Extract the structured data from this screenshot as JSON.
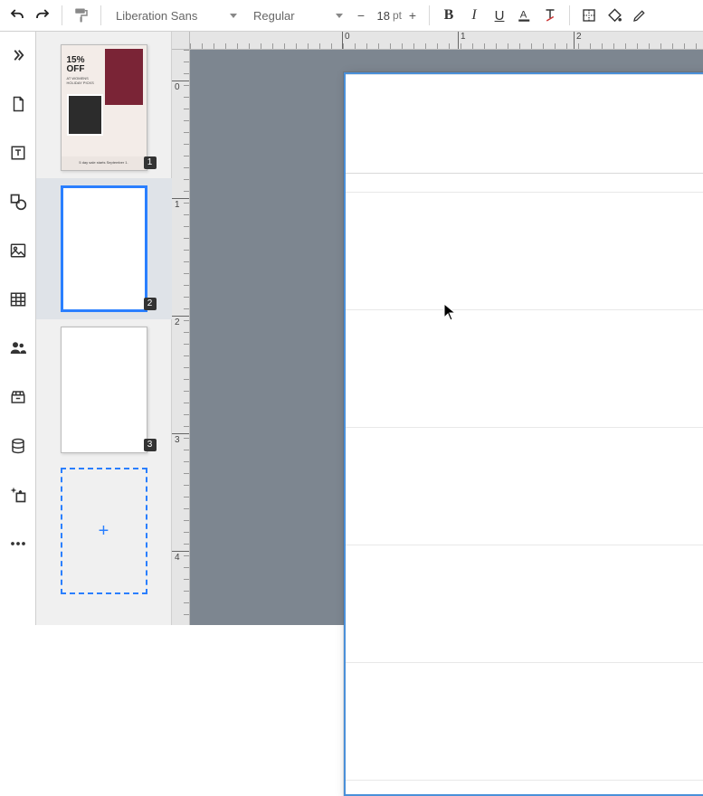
{
  "toolbar": {
    "font_family": "Liberation Sans",
    "font_style": "Regular",
    "font_size": "18",
    "font_unit": "pt"
  },
  "slides": [
    {
      "num": "1",
      "headline": "15%",
      "headline2": "OFF",
      "sub": "AT WOMENS HOLIDAY PICKS",
      "footer": "5 day sale starts September 1.",
      "brand": ""
    },
    {
      "num": "2",
      "brand": ""
    },
    {
      "num": "3",
      "brand": ""
    }
  ],
  "ruler": {
    "h": [
      {
        "pos": 168,
        "label": "0"
      },
      {
        "pos": 296,
        "label": "1"
      },
      {
        "pos": 424,
        "label": "2"
      }
    ],
    "v": [
      {
        "pos": 34,
        "label": "0"
      },
      {
        "pos": 164,
        "label": "1"
      },
      {
        "pos": 294,
        "label": "2"
      },
      {
        "pos": 424,
        "label": "3"
      },
      {
        "pos": 554,
        "label": "4"
      }
    ]
  }
}
